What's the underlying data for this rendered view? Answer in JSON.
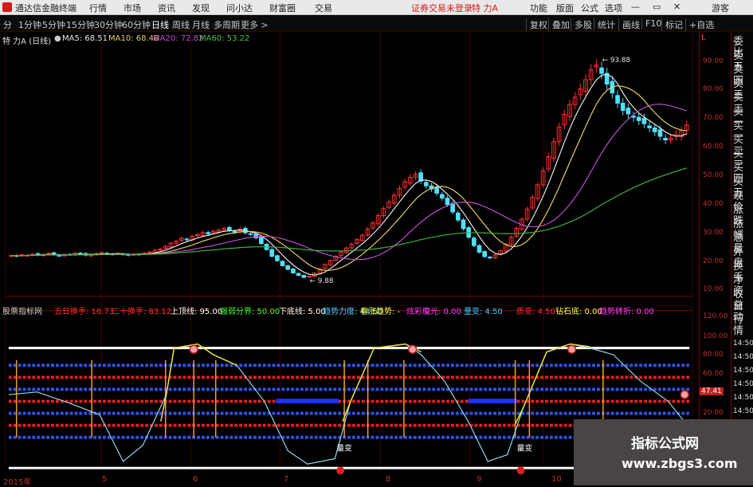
{
  "app": {
    "title": "通达信金融终端",
    "menu": [
      "行情",
      "市场",
      "资讯",
      "发现",
      "问小达",
      "财富圈",
      "交易"
    ],
    "notice": "证券交易未登录",
    "stock_name": "特 力A",
    "right_menu": [
      "功能",
      "版面",
      "公式",
      "选项"
    ],
    "guest": "游客"
  },
  "toolbar": {
    "periods": [
      "分",
      "1分钟",
      "5分钟",
      "15分钟",
      "30分钟",
      "60分钟",
      "日线",
      "周线",
      "月线",
      "多周期",
      "更多 >"
    ],
    "active": "日线",
    "right_buttons": [
      "复权",
      "叠加",
      "多股",
      "统计",
      "画线",
      "F10",
      "标记",
      "+自选"
    ]
  },
  "ma_header": {
    "name": "特 力A (日线)",
    "items": [
      {
        "label": "MA5: 68.51",
        "color": "#e8e8e8"
      },
      {
        "label": "MA10: 68.48",
        "color": "#e8d060"
      },
      {
        "label": "MA20: 72.82",
        "color": "#c050d0"
      },
      {
        "label": "MA60: 53.22",
        "color": "#50c050"
      }
    ]
  },
  "price_axis": {
    "ticks": [
      "90.00",
      "80.00",
      "70.00",
      "60.00",
      "50.00",
      "40.00",
      "30.00",
      "20.00",
      "10.00"
    ],
    "high_label": "93.88",
    "low_label": "9.88"
  },
  "indicator_header": {
    "name": "股票指标网",
    "items": [
      {
        "label": "五日换手: 16.73",
        "color": "#ff3030"
      },
      {
        "label": "二十换手: 83.12",
        "color": "#ff3030"
      },
      {
        "label": "上顶线: 95.00",
        "color": "#ffffff"
      },
      {
        "label": "强弱分界: 50.00",
        "color": "#30ff30"
      },
      {
        "label": "下底线: 5.00",
        "color": "#ffffff"
      },
      {
        "label": "趋势力度: 44.50",
        "color": "#40d0ff"
      },
      {
        "label": "看涨趋势: -",
        "color": "#ffff40"
      },
      {
        "label": "炫彩魔光: 0.00",
        "color": "#ff40ff"
      },
      {
        "label": "量变: 4.50",
        "color": "#40d0ff"
      },
      {
        "label": "质变: 4.50",
        "color": "#ff3030"
      },
      {
        "label": "钻石底: 0.00",
        "color": "#ffff40"
      },
      {
        "label": "趋势转折: 0.00",
        "color": "#ff40ff"
      }
    ]
  },
  "indicator_axis": {
    "ticks": [
      "120.00",
      "100.00",
      "80.00",
      "60.00",
      "40.00",
      "20.00"
    ],
    "value_label": "47.41",
    "annotations": [
      "量变",
      "量变"
    ]
  },
  "right_panel": {
    "items": [
      "委比",
      "卖五",
      "卖四",
      "卖三",
      "卖二",
      "卖一",
      "买一",
      "买二",
      "买三",
      "买四",
      "买五",
      "现价",
      "涨跌",
      "涨幅",
      "总量",
      "外盘",
      "换手",
      "净资",
      "收益",
      "自动",
      "行情",
      "14:50",
      "14:50",
      "14:50",
      "14:50",
      "14:50",
      "14:50",
      "14:50"
    ]
  },
  "x_axis": {
    "labels": [
      "2015年",
      "5",
      "6",
      "7",
      "8",
      "9",
      "10"
    ]
  },
  "watermark": {
    "line1": "指标公式网",
    "line2": "www.zbgs3.com"
  },
  "chart_data": {
    "type": "candlestick",
    "title": "特 力A (日线)",
    "x_labels": [
      "2015年",
      "5",
      "6",
      "7",
      "8",
      "9",
      "10"
    ],
    "ylim": [
      5,
      100
    ],
    "close": [
      18.5,
      18.2,
      18.8,
      18.6,
      19.0,
      18.7,
      18.9,
      19.3,
      18.8,
      18.5,
      18.7,
      18.9,
      19.4,
      19.0,
      18.6,
      18.8,
      19.2,
      19.6,
      19.1,
      18.9,
      19.3,
      19.0,
      18.6,
      18.9,
      19.1,
      19.4,
      19.8,
      20.5,
      21.0,
      22.0,
      23.2,
      24.0,
      25.1,
      24.5,
      25.8,
      26.5,
      27.3,
      26.8,
      27.8,
      28.2,
      28.9,
      28.1,
      27.5,
      28.6,
      27.2,
      26.7,
      25.3,
      23.1,
      20.8,
      18.2,
      16.5,
      14.6,
      13.2,
      11.8,
      10.9,
      10.1,
      10.6,
      11.8,
      13.4,
      15.1,
      16.6,
      18.2,
      19.8,
      21.4,
      22.9,
      24.6,
      26.3,
      28.7,
      31.0,
      33.8,
      36.5,
      39.0,
      41.6,
      44.2,
      46.8,
      48.5,
      49.6,
      47.1,
      45.2,
      44.0,
      42.4,
      40.5,
      38.0,
      35.2,
      32.1,
      28.8,
      25.5,
      22.3,
      19.8,
      18.1,
      17.6,
      18.7,
      20.4,
      22.8,
      25.6,
      28.9,
      32.4,
      36.3,
      40.8,
      45.6,
      51.0,
      56.4,
      62.1,
      67.8,
      72.6,
      76.4,
      79.2,
      82.4,
      85.9,
      89.7,
      91.5,
      88.3,
      84.2,
      80.8,
      76.9,
      74.1,
      72.8,
      71.5,
      70.2,
      69.0,
      67.4,
      65.9,
      64.2,
      62.8,
      63.5,
      64.9,
      66.4,
      68.5
    ],
    "series": [
      {
        "name": "MA5",
        "last": 68.51
      },
      {
        "name": "MA10",
        "last": 68.48
      },
      {
        "name": "MA20",
        "last": 72.82
      },
      {
        "name": "MA60",
        "last": 53.22
      }
    ],
    "colors": {
      "up": "#ff3030",
      "down": "#50e0ff",
      "ma5": "#e8e8e8",
      "ma10": "#e8d060",
      "ma20": "#c050d0",
      "ma60": "#40b040"
    }
  }
}
